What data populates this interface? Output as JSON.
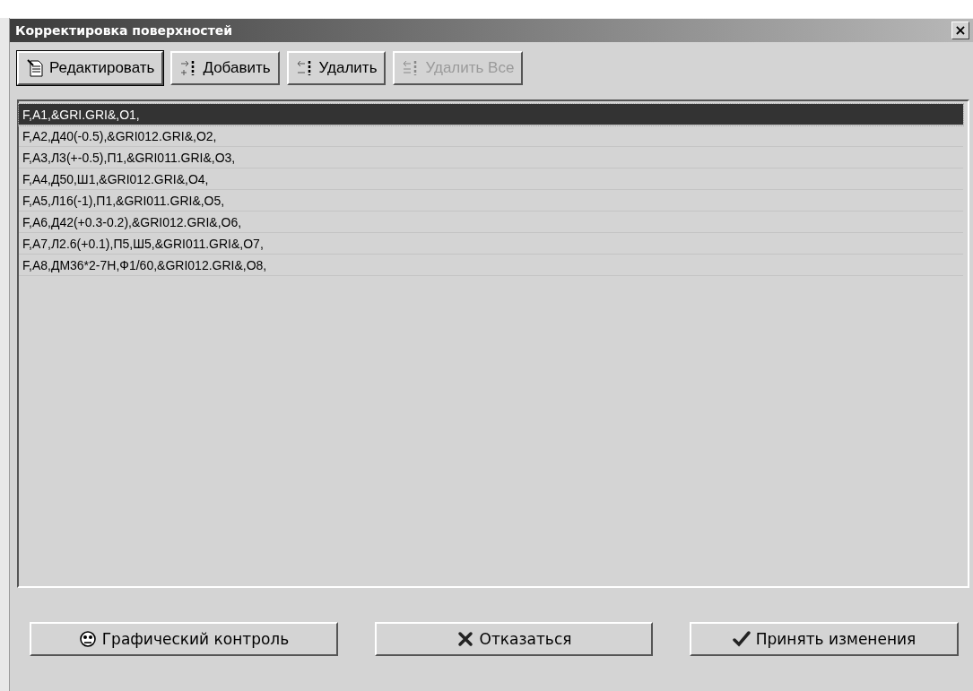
{
  "window": {
    "title": "Корректировка поверхностей",
    "close": "×"
  },
  "toolbar": [
    {
      "label": "Редактировать",
      "kind": "edit",
      "disabled": false,
      "default": true
    },
    {
      "label": "Добавить",
      "kind": "add",
      "disabled": false,
      "default": false
    },
    {
      "label": "Удалить",
      "kind": "delete",
      "disabled": false,
      "default": false
    },
    {
      "label": "Удалить Все",
      "kind": "delete_all",
      "disabled": true,
      "default": false
    }
  ],
  "rows": [
    {
      "text": "F,A1,&GRI.GRI&,O1,",
      "selected": true
    },
    {
      "text": "F,A2,Д40(-0.5),&GRI012.GRI&,O2,",
      "selected": false
    },
    {
      "text": "F,A3,Л3(+-0.5),П1,&GRI011.GRI&,O3,",
      "selected": false
    },
    {
      "text": "F,A4,Д50,Ш1,&GRI012.GRI&,O4,",
      "selected": false
    },
    {
      "text": "F,A5,Л16(-1),П1,&GRI011.GRI&,O5,",
      "selected": false
    },
    {
      "text": "F,A6,Д42(+0.3-0.2),&GRI012.GRI&,O6,",
      "selected": false
    },
    {
      "text": "F,A7,Л2.6(+0.1),П5,Ш5,&GRI011.GRI&,O7,",
      "selected": false
    },
    {
      "text": "F,A8,ДМ36*2-7H,Ф1/60,&GRI012.GRI&,O8,",
      "selected": false
    }
  ],
  "footer": [
    {
      "label": "Графический контроль",
      "kind": "graphic"
    },
    {
      "label": "Отказаться",
      "kind": "cancel"
    },
    {
      "label": "Принять изменения",
      "kind": "accept"
    }
  ]
}
